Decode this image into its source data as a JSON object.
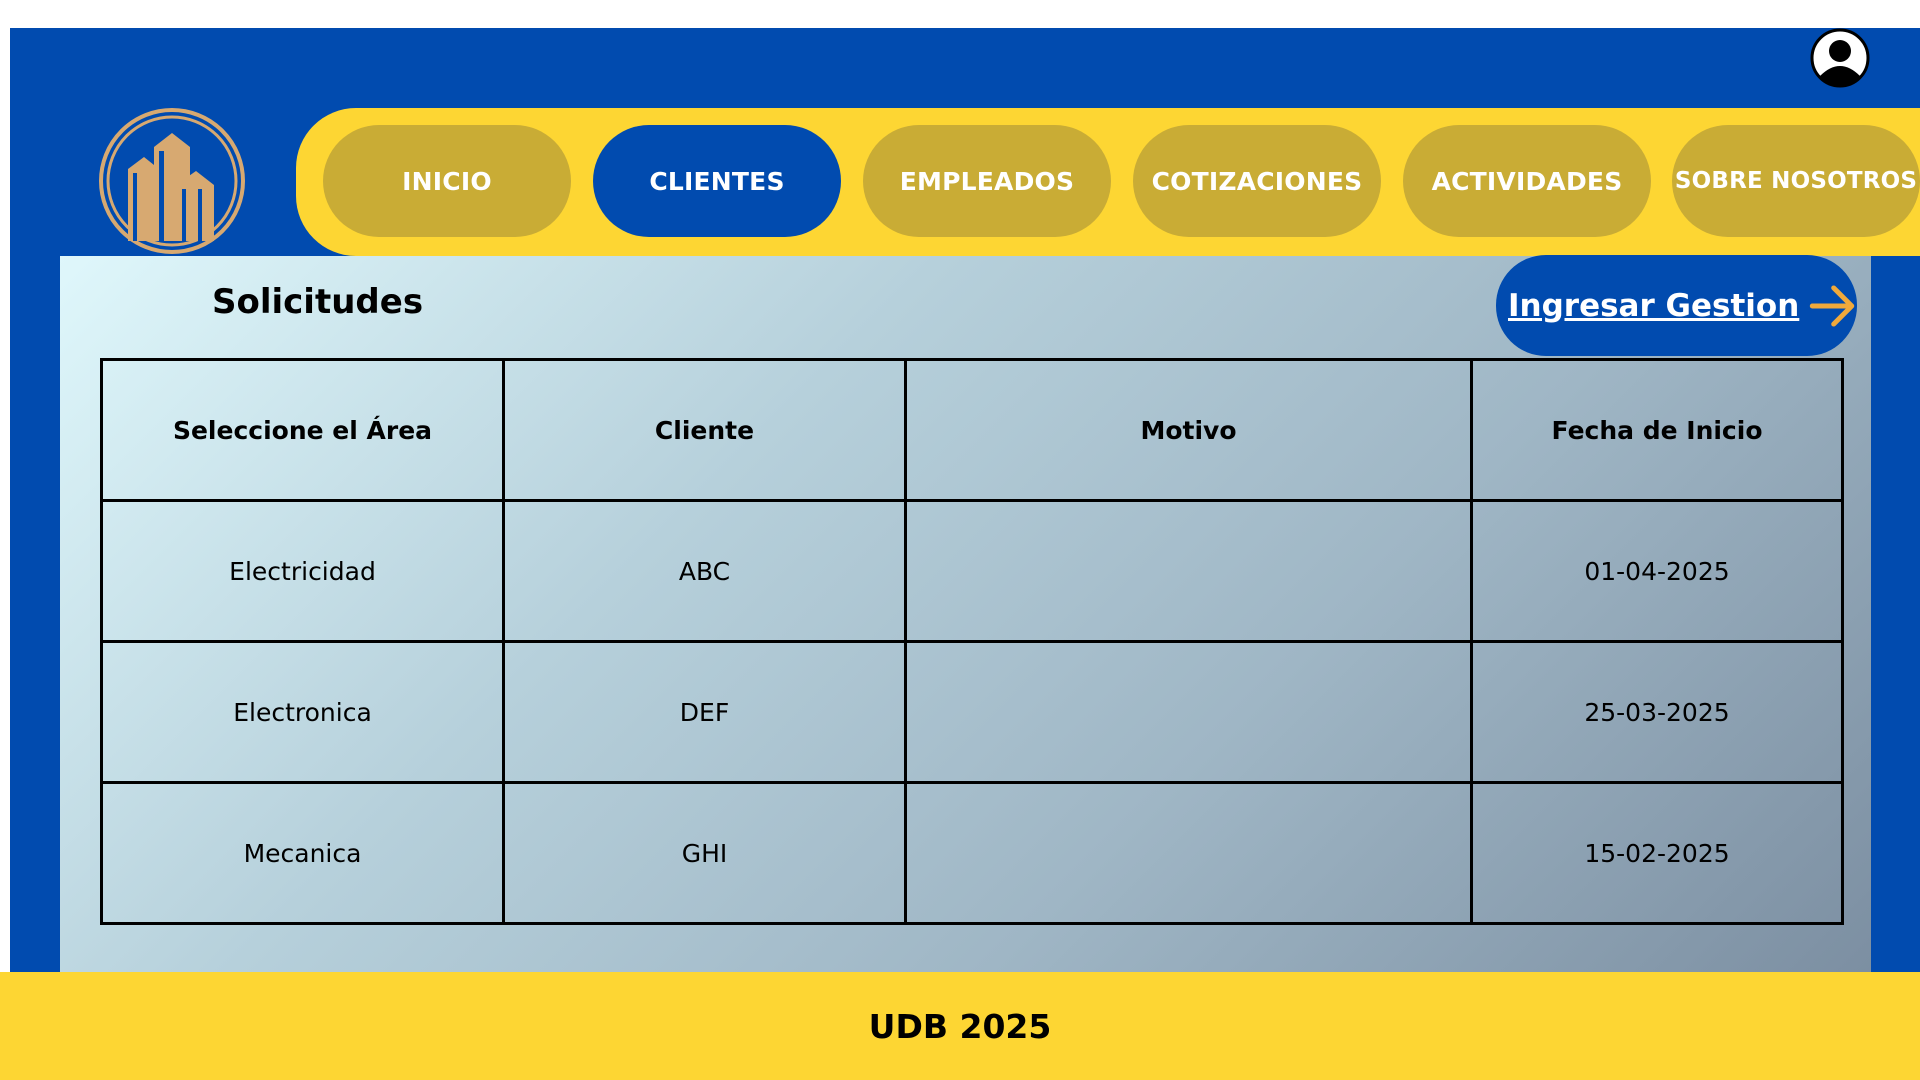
{
  "header": {
    "user_icon": "user-avatar-icon",
    "logo_icon": "buildings-logo-icon"
  },
  "nav": {
    "items": [
      {
        "label": "INICIO",
        "active": false
      },
      {
        "label": "CLIENTES",
        "active": true
      },
      {
        "label": "EMPLEADOS",
        "active": false
      },
      {
        "label": "COTIZACIONES",
        "active": false
      },
      {
        "label": "ACTIVIDADES",
        "active": false
      },
      {
        "label": "SOBRE NOSOTROS",
        "active": false
      }
    ]
  },
  "main": {
    "title": "Solicitudes",
    "gestion_button": {
      "label": "Ingresar Gestion",
      "icon": "arrow-right-icon"
    },
    "table": {
      "headers": [
        "Seleccione el Área",
        "Cliente",
        "Motivo",
        "Fecha de Inicio"
      ],
      "rows": [
        [
          "Electricidad",
          "ABC",
          "",
          "01-04-2025"
        ],
        [
          "Electronica",
          "DEF",
          "",
          "25-03-2025"
        ],
        [
          "Mecanica",
          "GHI",
          "",
          "15-02-2025"
        ]
      ]
    }
  },
  "footer": {
    "text": "UDB 2025"
  },
  "colors": {
    "primary_blue": "#014baf",
    "nav_yellow": "#fdd633",
    "nav_button_gold": "#c9ac35",
    "logo_gold": "#d7a971",
    "arrow_orange": "#f0a93b"
  }
}
